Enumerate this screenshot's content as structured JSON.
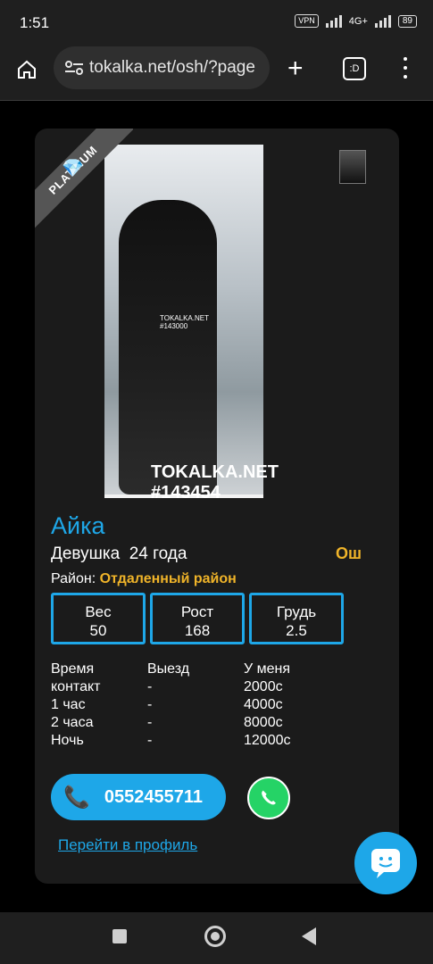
{
  "status_bar": {
    "time": "1:51",
    "vpn_label": "VPN",
    "network_label": "4G+",
    "battery": "89"
  },
  "browser": {
    "url": "tokalka.net/osh/?page",
    "tabs_label": ":D"
  },
  "profile": {
    "badge": "PLATINUM",
    "photo_watermark": [
      "TOKALKA.NET",
      "#143000"
    ],
    "overlay_brand": "TOKALKA.NET",
    "overlay_id": "#143454",
    "name": "Айка",
    "type": "Девушка",
    "age": "24 года",
    "city": "Ош",
    "district_label": "Район:",
    "district": "Отдаленный район",
    "params": [
      {
        "label": "Вес",
        "value": "50"
      },
      {
        "label": "Рост",
        "value": "168"
      },
      {
        "label": "Грудь",
        "value": "2.5"
      }
    ],
    "prices": {
      "headers": [
        "Время",
        "Выезд",
        "У меня"
      ],
      "rows": [
        [
          "контакт",
          "-",
          "2000с"
        ],
        [
          "1 час",
          "-",
          "4000с"
        ],
        [
          "2 часа",
          "-",
          "8000с"
        ],
        [
          "Ночь",
          "-",
          "12000с"
        ]
      ]
    },
    "phone": "0552455711",
    "profile_link": "Перейти в профиль"
  },
  "colors": {
    "accent": "#1ea7e8",
    "highlight": "#f0b429",
    "whatsapp": "#25d366",
    "card": "#1b1b1b"
  }
}
